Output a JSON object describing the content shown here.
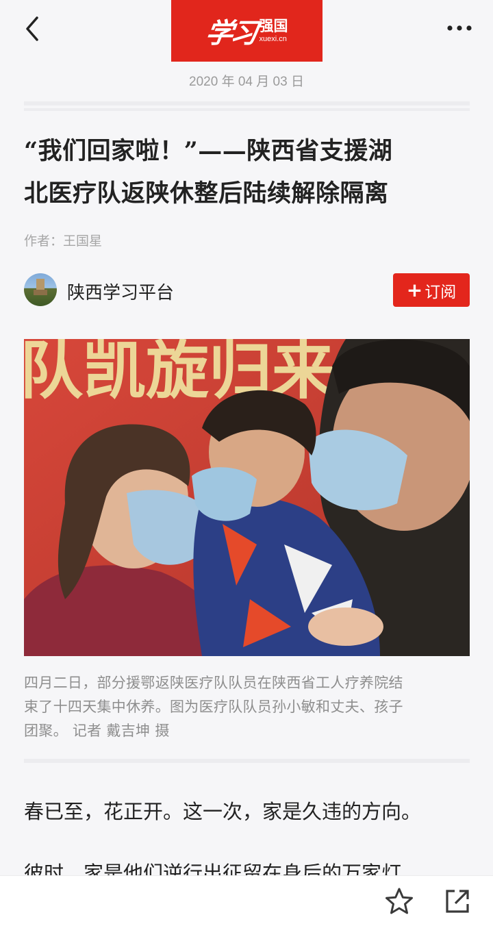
{
  "header": {
    "logo_calligraphy": "学习",
    "logo_text": "强国",
    "logo_url": "xuexi.cn",
    "date": "2020 年 04 月 03 日"
  },
  "article": {
    "title_line1": "“我们回家啦！”——陕西省支援湖",
    "title_line2": "北医疗队返陕休整后陆续解除隔离",
    "author": "作者：王国星",
    "publisher": "陕西学习平台",
    "subscribe_label": "订阅",
    "photo_banner_text": "队凯旋归来",
    "caption_line1": "四月二日，部分援鄂返陕医疗队队员在陕西省工人疗养院结",
    "caption_line2": "束了十四天集中休养。图为医疗队队员孙小敏和丈夫、孩子",
    "caption_line3": "团聚。 记者 戴吉坤 摄",
    "paragraph1": "春已至，花正开。这一次，家是久违的方向。",
    "paragraph2": "彼时，家是他们逆行出征留在身后的万家灯"
  },
  "colors": {
    "brand_red": "#e1261c",
    "background": "#f6f6f8",
    "text_dark": "#222222",
    "text_muted": "#9a9a9a"
  },
  "icons": {
    "back": "back-chevron-icon",
    "more": "more-dots-icon",
    "star": "star-icon",
    "share": "share-icon"
  }
}
